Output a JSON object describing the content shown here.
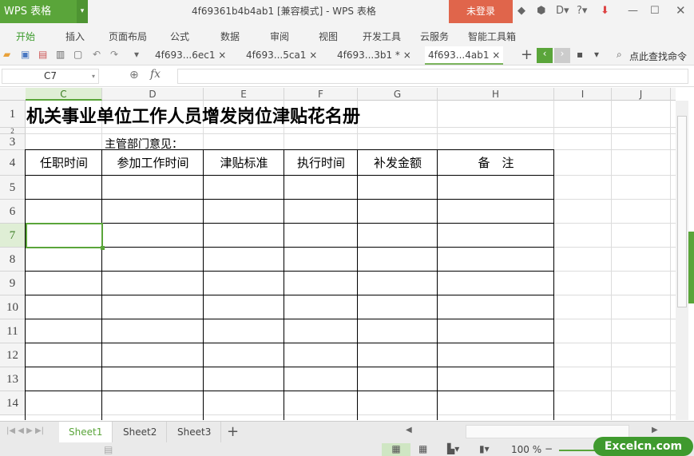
{
  "app": {
    "logo": "WPS 表格",
    "title": "4f69361b4b4ab1 [兼容模式] - WPS 表格",
    "login": "未登录"
  },
  "menu": [
    "开始",
    "插入",
    "页面布局",
    "公式",
    "数据",
    "审阅",
    "视图",
    "开发工具",
    "云服务",
    "智能工具箱"
  ],
  "doc_tabs": [
    {
      "label": "4f693...6ec1 ×"
    },
    {
      "label": "4f693...5ca1 ×"
    },
    {
      "label": "4f693...3b1 * ×"
    },
    {
      "label": "4f693...4ab1 ×"
    }
  ],
  "search": "点此查找命令",
  "namebox": "C7",
  "fx": "fx",
  "columns": [
    "C",
    "D",
    "E",
    "F",
    "G",
    "H",
    "I",
    "J"
  ],
  "rows": [
    "1",
    "2",
    "3",
    "4",
    "5",
    "6",
    "7",
    "8",
    "9",
    "10",
    "11",
    "12",
    "13",
    "14"
  ],
  "sheet": {
    "title": "机关事业单位工作人员增发岗位津贴花名册",
    "dept": "主管部门意见：",
    "headers": [
      "任职时间",
      "参加工作时间",
      "津贴标准",
      "执行时间",
      "补发金额",
      "备　注"
    ]
  },
  "sheets": [
    "Sheet1",
    "Sheet2",
    "Sheet3"
  ],
  "zoom": "100 %",
  "brand": "Excelcn.com",
  "colors": {
    "accent": "#5aa53a",
    "login": "#e0654b"
  }
}
